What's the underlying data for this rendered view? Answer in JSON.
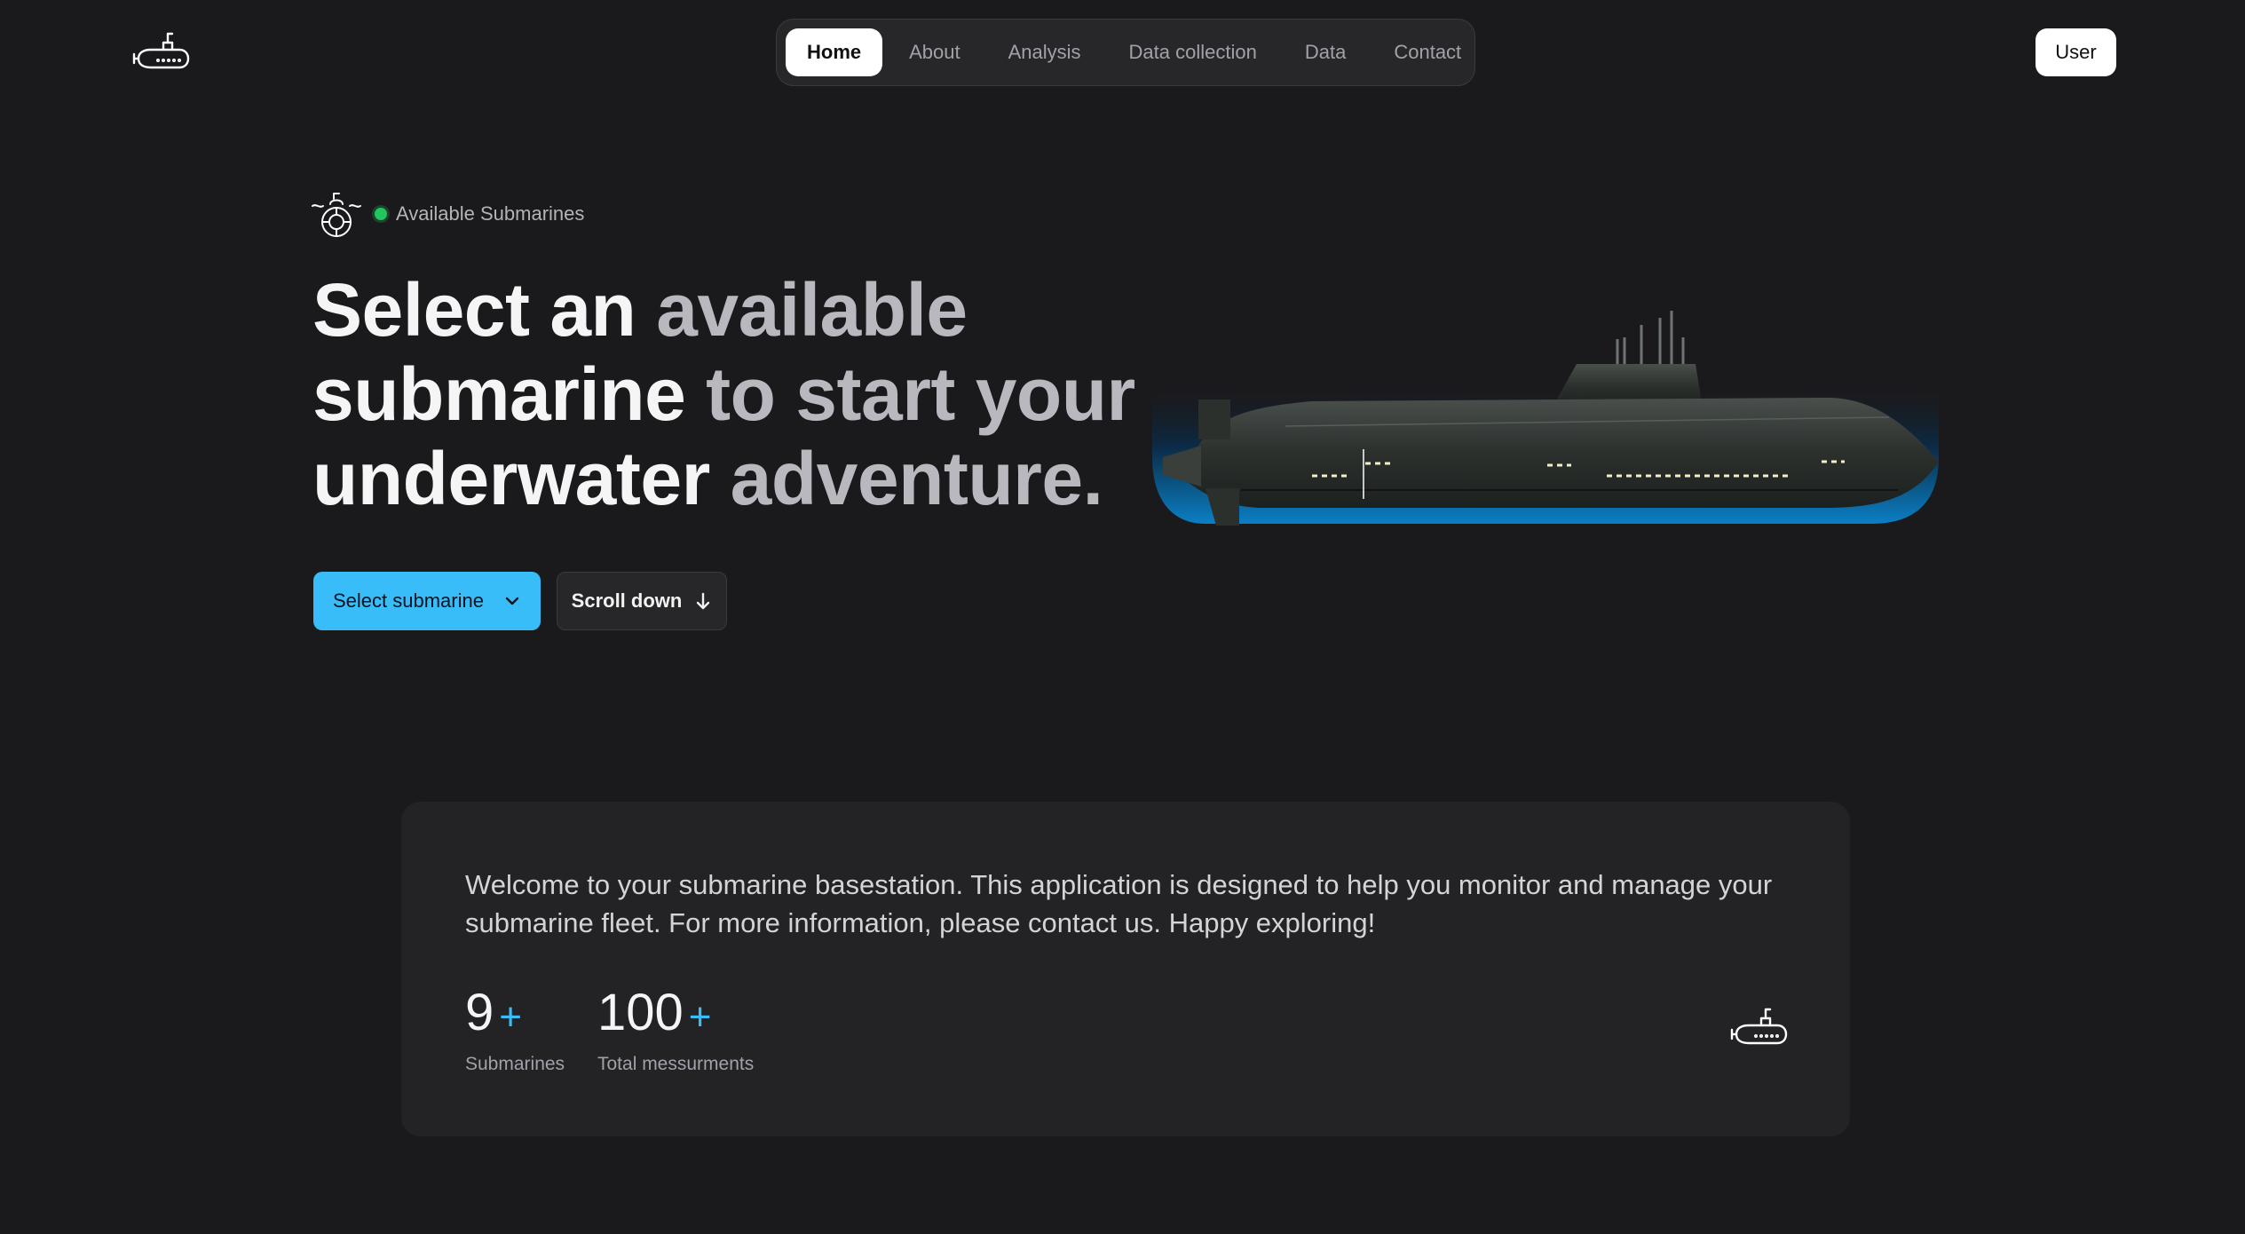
{
  "nav": {
    "items": [
      {
        "label": "Home",
        "active": true
      },
      {
        "label": "About"
      },
      {
        "label": "Analysis"
      },
      {
        "label": "Data collection"
      },
      {
        "label": "Data"
      },
      {
        "label": "Contact"
      }
    ],
    "user_label": "User"
  },
  "hero": {
    "badge": "Available Submarines",
    "title_words": [
      "Select",
      "an",
      "available",
      "submarine",
      "to",
      "start",
      "your",
      "underwater",
      "adventure."
    ],
    "select_button": "Select submarine",
    "scroll_button": "Scroll down"
  },
  "info": {
    "text": "Welcome to your submarine basestation. This application is designed to help you monitor and manage your submarine fleet. For more information, please contact us. Happy exploring!",
    "stats": [
      {
        "value": "9",
        "suffix": "+",
        "label": "Submarines"
      },
      {
        "value": "100",
        "suffix": "+",
        "label": "Total messurments"
      }
    ]
  },
  "icons": {
    "logo": "submarine-icon",
    "badge": "submarine-periscope-icon",
    "select_chevron": "chevron-down-icon",
    "scroll_arrow": "arrow-down-icon",
    "card": "submarine-icon"
  },
  "colors": {
    "background": "#1a1a1d",
    "accent": "#38bdf8",
    "status": "#22c55e",
    "card": "#232326"
  }
}
